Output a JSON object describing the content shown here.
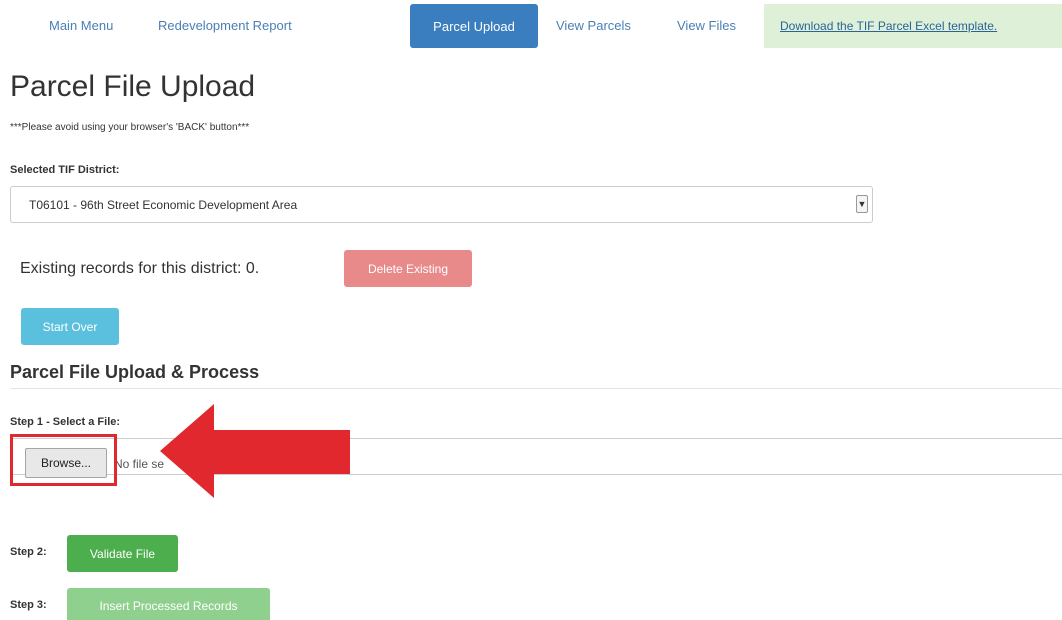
{
  "nav": {
    "main_menu": "Main Menu",
    "redevelopment_report": "Redevelopment Report",
    "parcel_upload": "Parcel Upload",
    "view_parcels": "View Parcels",
    "view_files": "View Files",
    "download_template": "Download the TIF Parcel Excel template."
  },
  "page": {
    "title": "Parcel File Upload",
    "warning": "***Please avoid using your browser's 'BACK' button***"
  },
  "district": {
    "label": "Selected TIF District:",
    "selected": "T06101 - 96th Street Economic Development Area"
  },
  "existing": {
    "text": "Existing records for this district: 0.",
    "delete_label": "Delete Existing"
  },
  "start_over_label": "Start Over",
  "process": {
    "section_title": "Parcel File Upload & Process",
    "step1_label": "Step 1 - Select a File:",
    "browse_label": "Browse...",
    "no_file_text": "No file se",
    "step2_label": "Step 2:",
    "validate_label": "Validate File",
    "step3_label": "Step 3:",
    "insert_label": "Insert Processed Records"
  },
  "colors": {
    "primary": "#3a7ebf",
    "danger": "#e8898a",
    "info": "#5bc0de",
    "success": "#4cae4c",
    "success_disabled": "#8fd08f",
    "annotation": "#e0282e"
  },
  "icons": {
    "select_arrow": "chevron-down-icon",
    "annotation_arrow": "arrow-left-icon"
  }
}
